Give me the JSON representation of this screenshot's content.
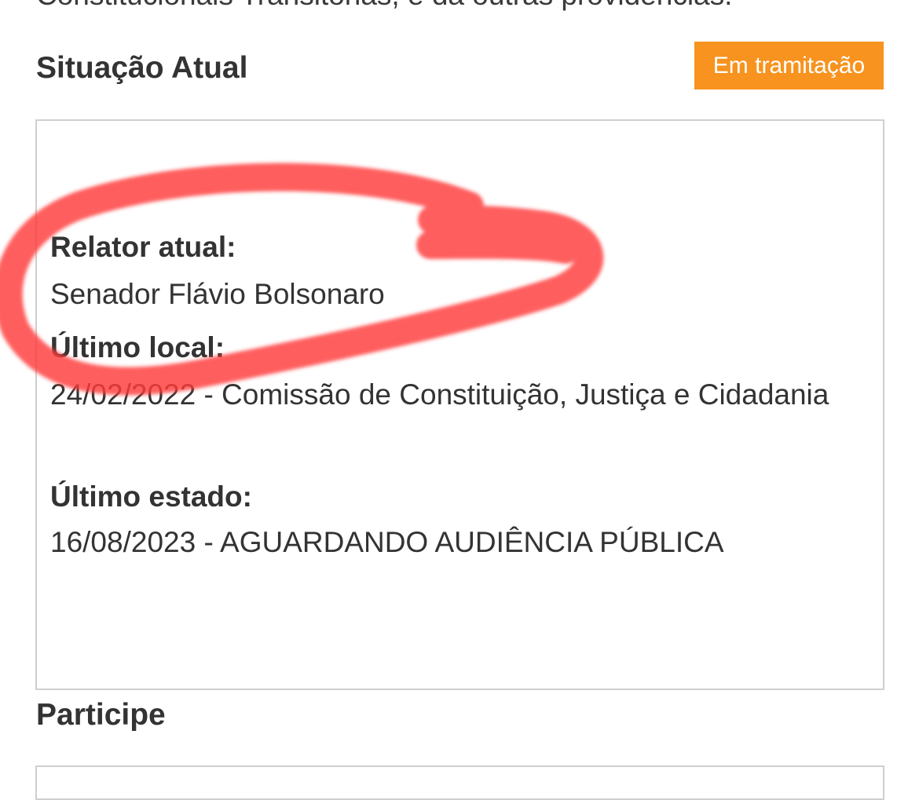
{
  "page": {
    "cut_off_text": "Constitucionais Transitórias, e dá outras providências."
  },
  "situacao": {
    "title": "Situação Atual",
    "status_badge": "Em tramitação",
    "relator_label": "Relator atual:",
    "relator_value": "Senador Flávio Bolsonaro",
    "ultimo_local_label": "Último local:",
    "ultimo_local_value": "24/02/2022 - Comissão de Constituição, Justiça e Cidadania",
    "ultimo_estado_label": "Último estado:",
    "ultimo_estado_value": "16/08/2023 - AGUARDANDO AUDIÊNCIA PÚBLICA"
  },
  "participe": {
    "title": "Participe"
  },
  "colors": {
    "badge": "#f7931e",
    "annotation": "#ff3b3b",
    "border": "#cfcfcf",
    "text": "#333333"
  }
}
